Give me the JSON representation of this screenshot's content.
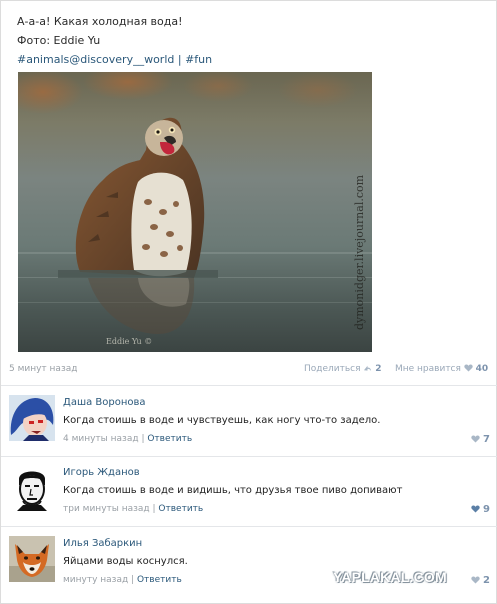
{
  "post": {
    "line1": "А-а-а! Какая холодная вода!",
    "line2": "Фото: Eddie Yu",
    "tag1": "#animals@discovery__world",
    "tag_separator": "|",
    "tag2": "#fun",
    "photo_watermark_bottom": "Eddie Yu ©",
    "photo_watermark_side": "dymonidger.livejournal.com",
    "date": "5 минут назад",
    "share_label": "Поделиться",
    "share_count": "2",
    "like_label": "Мне нравится",
    "like_count": "40"
  },
  "comments": [
    {
      "author": "Даша Воронова",
      "text": "Когда стоишь в воде и чувствуешь, как ногу что-то задело.",
      "time": "4 минуты назад",
      "reply": "Ответить",
      "likes": "7",
      "avatar_icon": "anime-avatar-icon"
    },
    {
      "author": "Игорь Жданов",
      "text": "Когда стоишь в воде и видишь, что друзья твое пиво допивают",
      "time": "три минуты назад",
      "reply": "Ответить",
      "likes": "9",
      "avatar_icon": "face-sketch-avatar-icon"
    },
    {
      "author": "Илья Забаркин",
      "text": "Яйцами воды коснулся.",
      "time": "минуту назад",
      "reply": "Ответить",
      "likes": "2",
      "avatar_icon": "fox-avatar-icon"
    }
  ],
  "site_watermark": "YAPLAKAL.COM",
  "colors": {
    "link": "#2b587a",
    "meta_gray": "#9aa0a6",
    "like_blue": "#7d93ad"
  }
}
